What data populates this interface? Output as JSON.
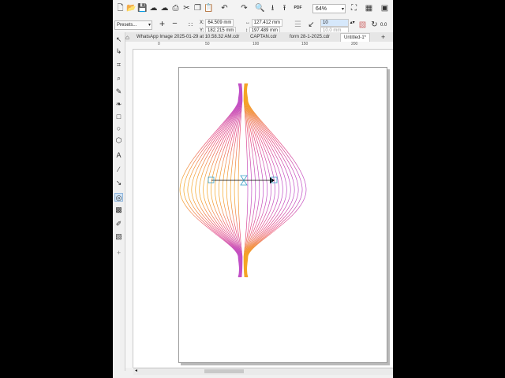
{
  "zoom": {
    "value": "64%"
  },
  "presets_label": "Presets...",
  "position": {
    "x_label": "X:",
    "x": "64.509 mm",
    "y_label": "Y:",
    "y": "182.215 mm"
  },
  "size": {
    "w": "127.412 mm",
    "h": "197.489 mm"
  },
  "spin_value_top": "10",
  "spin_value_bottom": "10.0 mm",
  "angle_value": "0.0",
  "tabs": [
    {
      "label": "WhatsApp Image 2025-01-29 at 10.58.32 AM.cdr"
    },
    {
      "label": "CAPTAN.cdr"
    },
    {
      "label": "form 28-1-2025.cdr"
    },
    {
      "label": "Untitled-1*"
    }
  ],
  "ruler_numbers": [
    "0",
    "50",
    "100",
    "150",
    "200"
  ],
  "pdf_label": "PDF",
  "colors": {
    "blend_start": "#f5a623",
    "blend_mid": "#e8487a",
    "blend_end": "#c04fc8",
    "selection": "#3aa0c8"
  }
}
